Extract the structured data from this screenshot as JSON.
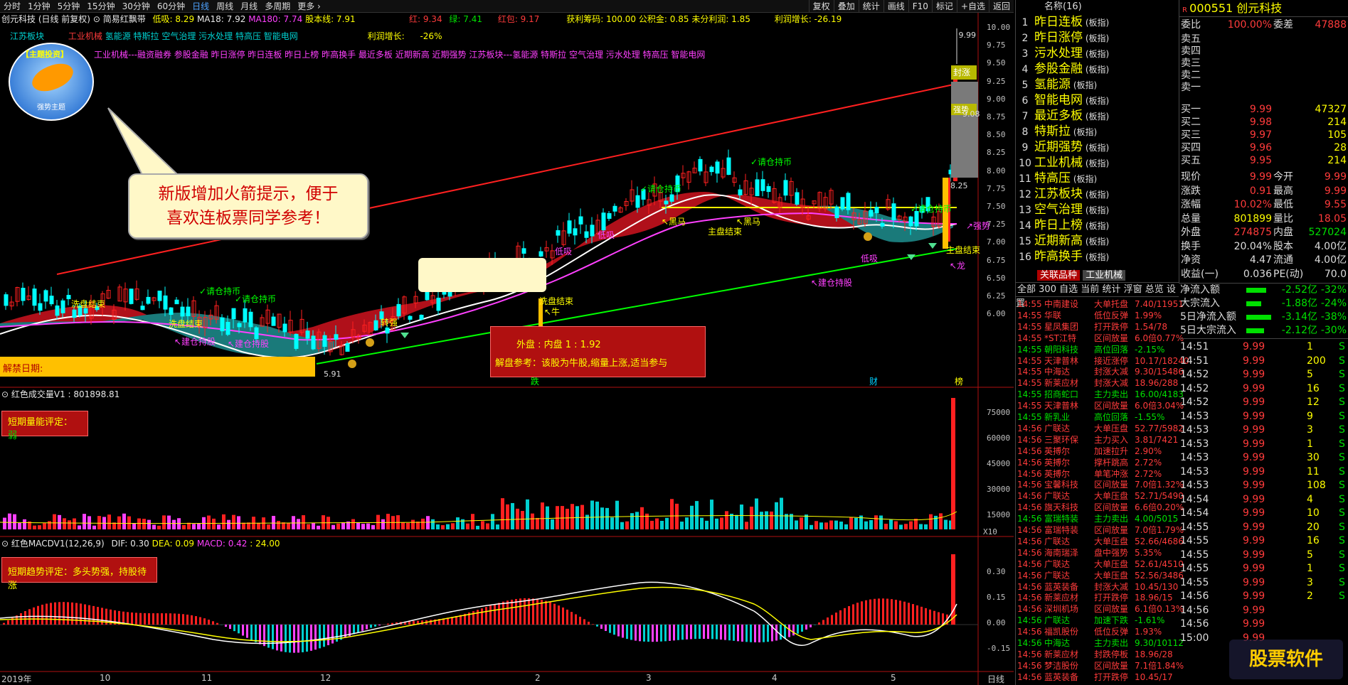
{
  "toolbar": {
    "periods": [
      "分时",
      "1分钟",
      "5分钟",
      "15分钟",
      "30分钟",
      "60分钟",
      "日线",
      "周线",
      "月线",
      "多周期",
      "更多 ›"
    ],
    "active_period": "日线",
    "right_buttons": [
      "复权",
      "叠加",
      "统计",
      "画线",
      "F10",
      "标记",
      "+自选",
      "返回"
    ]
  },
  "info_line": {
    "title": "创元科技 (日线 前复权)",
    "indicator": "简易红飘带",
    "low": "低吸: 8.29",
    "ma18": "MA18: 7.92",
    "ma180": "MA180: 7.74",
    "stock_line": "股本线: 7.91",
    "red": "红: 9.34",
    "green": "绿: 7.41",
    "redpack": "红包: 9.17",
    "profit_chips": "获利筹码: 100.00",
    "reserve": "公积金: 0.85",
    "undistributed": "未分利润: 1.85",
    "profit_growth": "利润增长: -26.19"
  },
  "concept_line1": {
    "a": "江苏板块",
    "b": "工业机械",
    "c": "氢能源 特斯拉 空气治理 污水处理 特高压 智能电网",
    "d": "利润增长:",
    "e": "-26%"
  },
  "concept_line2": "工业机械---融资融券 参股金融 昨日涨停 昨日连板 昨日上榜 昨高换手 最近多板 近期新高 近期强势 江苏板块---氢能源 特斯拉 空气治理 污水处理 特高压 智能电网",
  "logo_label": "【主题投资】",
  "logo_sub": "强势主题",
  "bubble_text": [
    "新版增加火箭提示，便于",
    "喜欢连板票同学参考！"
  ],
  "unlock_label": "解禁日期:",
  "redbox": {
    "line1": "外盘 : 内盘   1 : 1.92",
    "line2": "解盘参考：该股为牛股,缩量上涨,适当参与"
  },
  "chart_labels": {
    "hold": "✓请仓持币",
    "build": "↖建仓持股",
    "wash_end": "洗盘结束",
    "wash_end2": "洗盘结束",
    "turn_strong": "转强",
    "low_buy": "低吸",
    "black_horse": "↖黑马",
    "bull": "↖牛",
    "main_end": "主盘结束",
    "dragon": "↖龙",
    "fall": "跌",
    "wealth": "财",
    "list": "榜",
    "peak": "9.99",
    "peak_label": "封涨",
    "strong": "强势",
    "suspend": "↗强势",
    "mid_price": "8.25",
    "price_908": "9.08",
    "low_price": "5.91"
  },
  "price_axis": [
    "10.00",
    "9.75",
    "9.50",
    "9.25",
    "9.00",
    "8.75",
    "8.50",
    "8.25",
    "8.00",
    "7.75",
    "7.50",
    "7.25",
    "7.00",
    "6.75",
    "6.50",
    "6.25",
    "6.00"
  ],
  "volume_panel": {
    "title": "红色成交量V1 : 801898.81",
    "box": "短期量能评定：",
    "box_value": "弱",
    "axis": [
      "75000",
      "60000",
      "45000",
      "30000",
      "15000"
    ],
    "unit": "X10"
  },
  "macd_panel": {
    "title": "红色MACDV1(12,26,9)",
    "dif": "DIF: 0.30",
    "dea": "DEA: 0.09",
    "macd": "MACD: 0.42",
    "extra": ": 24.00",
    "box": "短期趋势评定：多头势强，持股待涨",
    "axis": [
      "0.30",
      "0.15",
      "0.00",
      "-0.15"
    ]
  },
  "x_axis": [
    "2019年",
    "10",
    "11",
    "12",
    "2",
    "3",
    "4",
    "5"
  ],
  "x_axis_right": "日线",
  "plate_list": {
    "header": "名称(16)",
    "items": [
      {
        "n": "1",
        "name": "昨日连板",
        "tag": "(板指)"
      },
      {
        "n": "2",
        "name": "昨日涨停",
        "tag": "(板指)"
      },
      {
        "n": "3",
        "name": "污水处理",
        "tag": "(板指)"
      },
      {
        "n": "4",
        "name": "参股金融",
        "tag": "(板指)"
      },
      {
        "n": "5",
        "name": "氢能源",
        "tag": "(板指)"
      },
      {
        "n": "6",
        "name": "智能电网",
        "tag": "(板指)"
      },
      {
        "n": "7",
        "name": "最近多板",
        "tag": "(板指)"
      },
      {
        "n": "8",
        "name": "特斯拉",
        "tag": "(板指)"
      },
      {
        "n": "9",
        "name": "近期强势",
        "tag": "(板指)"
      },
      {
        "n": "10",
        "name": "工业机械",
        "tag": "(板指)"
      },
      {
        "n": "11",
        "name": "特高压",
        "tag": "(板指)"
      },
      {
        "n": "12",
        "name": "江苏板块",
        "tag": "(板指)"
      },
      {
        "n": "13",
        "name": "空气治理",
        "tag": "(板指)"
      },
      {
        "n": "14",
        "name": "昨日上榜",
        "tag": "(板指)"
      },
      {
        "n": "15",
        "name": "近期新高",
        "tag": "(板指)"
      },
      {
        "n": "16",
        "name": "昨高换手",
        "tag": "(板指)"
      }
    ]
  },
  "stock_panel": {
    "header": "000551 创元科技",
    "wb": {
      "label": "委比",
      "v": "100.00%",
      "l2": "委差",
      "v2": "47888"
    },
    "asks": [
      {
        "l": "卖五",
        "p": "",
        "q": ""
      },
      {
        "l": "卖四",
        "p": "",
        "q": ""
      },
      {
        "l": "卖三",
        "p": "",
        "q": ""
      },
      {
        "l": "卖二",
        "p": "",
        "q": ""
      },
      {
        "l": "卖一",
        "p": "",
        "q": ""
      }
    ],
    "bids": [
      {
        "l": "买一",
        "p": "9.99",
        "q": "47327"
      },
      {
        "l": "买二",
        "p": "9.98",
        "q": "214"
      },
      {
        "l": "买三",
        "p": "9.97",
        "q": "105"
      },
      {
        "l": "买四",
        "p": "9.96",
        "q": "28"
      },
      {
        "l": "买五",
        "p": "9.95",
        "q": "214"
      }
    ],
    "stats": [
      {
        "l": "现价",
        "v": "9.99",
        "l2": "今开",
        "v2": "9.99"
      },
      {
        "l": "涨跌",
        "v": "0.91",
        "l2": "最高",
        "v2": "9.99"
      },
      {
        "l": "涨幅",
        "v": "10.02%",
        "l2": "最低",
        "v2": "9.55"
      },
      {
        "l": "总量",
        "v": "801899",
        "l2": "量比",
        "v2": "18.05"
      },
      {
        "l": "外盘",
        "v": "274875",
        "l2": "内盘",
        "v2": "527024"
      },
      {
        "l": "换手",
        "v": "20.04%",
        "l2": "股本",
        "v2": "4.00亿"
      },
      {
        "l": "净资",
        "v": "4.47",
        "l2": "流通",
        "v2": "4.00亿"
      },
      {
        "l": "收益(一)",
        "v": "0.036",
        "l2": "PE(动)",
        "v2": "70.0"
      }
    ]
  },
  "fund_flow": [
    {
      "l": "净流入额",
      "v": "-2.52亿",
      "p": "-32%",
      "bar": 0.55
    },
    {
      "l": "大宗流入",
      "v": "-1.88亿",
      "p": "-24%",
      "bar": 0.42
    },
    {
      "l": "5日净流入额",
      "v": "-3.14亿",
      "p": "-38%",
      "bar": 0.7
    },
    {
      "l": "5日大宗流入",
      "v": "-2.12亿",
      "p": "-30%",
      "bar": 0.5
    }
  ],
  "tick_trades": [
    {
      "t": "14:51",
      "p": "9.99",
      "q": "1",
      "s": "S"
    },
    {
      "t": "14:51",
      "p": "9.99",
      "q": "200",
      "s": "S"
    },
    {
      "t": "14:52",
      "p": "9.99",
      "q": "5",
      "s": "S"
    },
    {
      "t": "14:52",
      "p": "9.99",
      "q": "16",
      "s": "S"
    },
    {
      "t": "14:52",
      "p": "9.99",
      "q": "12",
      "s": "S"
    },
    {
      "t": "14:53",
      "p": "9.99",
      "q": "9",
      "s": "S"
    },
    {
      "t": "14:53",
      "p": "9.99",
      "q": "3",
      "s": "S"
    },
    {
      "t": "14:53",
      "p": "9.99",
      "q": "1",
      "s": "S"
    },
    {
      "t": "14:53",
      "p": "9.99",
      "q": "30",
      "s": "S"
    },
    {
      "t": "14:53",
      "p": "9.99",
      "q": "11",
      "s": "S"
    },
    {
      "t": "14:53",
      "p": "9.99",
      "q": "108",
      "s": "S"
    },
    {
      "t": "14:54",
      "p": "9.99",
      "q": "4",
      "s": "S"
    },
    {
      "t": "14:54",
      "p": "9.99",
      "q": "10",
      "s": "S"
    },
    {
      "t": "14:55",
      "p": "9.99",
      "q": "20",
      "s": "S"
    },
    {
      "t": "14:55",
      "p": "9.99",
      "q": "16",
      "s": "S"
    },
    {
      "t": "14:55",
      "p": "9.99",
      "q": "5",
      "s": "S"
    },
    {
      "t": "14:55",
      "p": "9.99",
      "q": "1",
      "s": "S"
    },
    {
      "t": "14:55",
      "p": "9.99",
      "q": "3",
      "s": "S"
    },
    {
      "t": "14:56",
      "p": "9.99",
      "q": "2",
      "s": "S"
    },
    {
      "t": "14:56",
      "p": "9.99",
      "q": "",
      "s": ""
    },
    {
      "t": "14:56",
      "p": "9.99",
      "q": "",
      "s": ""
    },
    {
      "t": "15:00",
      "p": "9.99",
      "q": "",
      "s": ""
    }
  ],
  "news": {
    "tabs": [
      "关联品种",
      "工业机械"
    ],
    "sub": [
      "全部",
      "300",
      "自选",
      "当前",
      "统计",
      "浮窗",
      "总览",
      "设置"
    ],
    "rows": [
      {
        "t": "14:55",
        "n": "中南建设",
        "e": "大单托盘",
        "v": "7.40/11951"
      },
      {
        "t": "14:55",
        "n": "华联",
        "e": "低位反弹",
        "v": "1.99%"
      },
      {
        "t": "14:55",
        "n": "星凤集团",
        "e": "打开跌停",
        "v": "1.54/78"
      },
      {
        "t": "14:55",
        "n": "*ST江特",
        "e": "区间放量",
        "v": "6.0倍0.77%"
      },
      {
        "t": "14:55",
        "n": "朝阳科技",
        "e": "高位回落",
        "v": "-2.15%"
      },
      {
        "t": "14:55",
        "n": "天津普林",
        "e": "接近涨停",
        "v": "10.17/18240"
      },
      {
        "t": "14:55",
        "n": "中海达",
        "e": "封涨大减",
        "v": "9.30/15486"
      },
      {
        "t": "14:55",
        "n": "新莱应材",
        "e": "封涨大减",
        "v": "18.96/288"
      },
      {
        "t": "14:55",
        "n": "招商蛇口",
        "e": "主力卖出",
        "v": "16.00/4183"
      },
      {
        "t": "14:55",
        "n": "天津普林",
        "e": "区间放量",
        "v": "6.0倍3.04%"
      },
      {
        "t": "14:55",
        "n": "新乳业",
        "e": "高位回落",
        "v": "-1.55%"
      },
      {
        "t": "14:56",
        "n": "广联达",
        "e": "大单压盘",
        "v": "52.77/5982"
      },
      {
        "t": "14:56",
        "n": "三聚环保",
        "e": "主力买入",
        "v": "3.81/7421"
      },
      {
        "t": "14:56",
        "n": "英搏尔",
        "e": "加速拉升",
        "v": "2.90%"
      },
      {
        "t": "14:56",
        "n": "英搏尔",
        "e": "撑杆跳高",
        "v": "2.72%"
      },
      {
        "t": "14:56",
        "n": "英搏尔",
        "e": "单笔冲涨",
        "v": "2.72%"
      },
      {
        "t": "14:56",
        "n": "宝馨科技",
        "e": "区间放量",
        "v": "7.0倍1.32%"
      },
      {
        "t": "14:56",
        "n": "广联达",
        "e": "大单压盘",
        "v": "52.71/5490"
      },
      {
        "t": "14:56",
        "n": "旗天科技",
        "e": "区间放量",
        "v": "6.6倍0.20%"
      },
      {
        "t": "14:56",
        "n": "富瑞特装",
        "e": "主力卖出",
        "v": "4.00/5015"
      },
      {
        "t": "14:56",
        "n": "富瑞特装",
        "e": "区间放量",
        "v": "7.0倍1.79%"
      },
      {
        "t": "14:56",
        "n": "广联达",
        "e": "大单压盘",
        "v": "52.66/4686"
      },
      {
        "t": "14:56",
        "n": "海南瑞泽",
        "e": "盘中强势",
        "v": "5.35%"
      },
      {
        "t": "14:56",
        "n": "广联达",
        "e": "大单压盘",
        "v": "52.61/4510"
      },
      {
        "t": "14:56",
        "n": "广联达",
        "e": "大单压盘",
        "v": "52.56/3486"
      },
      {
        "t": "14:56",
        "n": "蓝英装备",
        "e": "封涨大减",
        "v": "10.45/130"
      },
      {
        "t": "14:56",
        "n": "新莱应材",
        "e": "打开跌停",
        "v": "18.96/15"
      },
      {
        "t": "14:56",
        "n": "深圳机场",
        "e": "区间放量",
        "v": "6.1倍0.13%"
      },
      {
        "t": "14:56",
        "n": "广联达",
        "e": "加速下跌",
        "v": "-1.61%"
      },
      {
        "t": "14:56",
        "n": "福凯股份",
        "e": "低位反弹",
        "v": "1.93%"
      },
      {
        "t": "14:56",
        "n": "中海达",
        "e": "主力卖出",
        "v": "9.30/10112"
      },
      {
        "t": "14:56",
        "n": "新莱应材",
        "e": "封跌停板",
        "v": "18.96/28"
      },
      {
        "t": "14:56",
        "n": "梦洁股份",
        "e": "区间放量",
        "v": "7.1倍1.84%"
      },
      {
        "t": "14:56",
        "n": "蓝英装备",
        "e": "打开跌停",
        "v": "10.45/17"
      }
    ]
  },
  "colors": {
    "up": "#ff2020",
    "down": "#00ffff",
    "ribbon_red": "#b0101a",
    "ribbon_teal": "#1a7a7a",
    "ma_white": "#ffffff",
    "ma_magenta": "#ff40ff",
    "trend_red": "#ff2020",
    "trend_green": "#00ff00"
  }
}
